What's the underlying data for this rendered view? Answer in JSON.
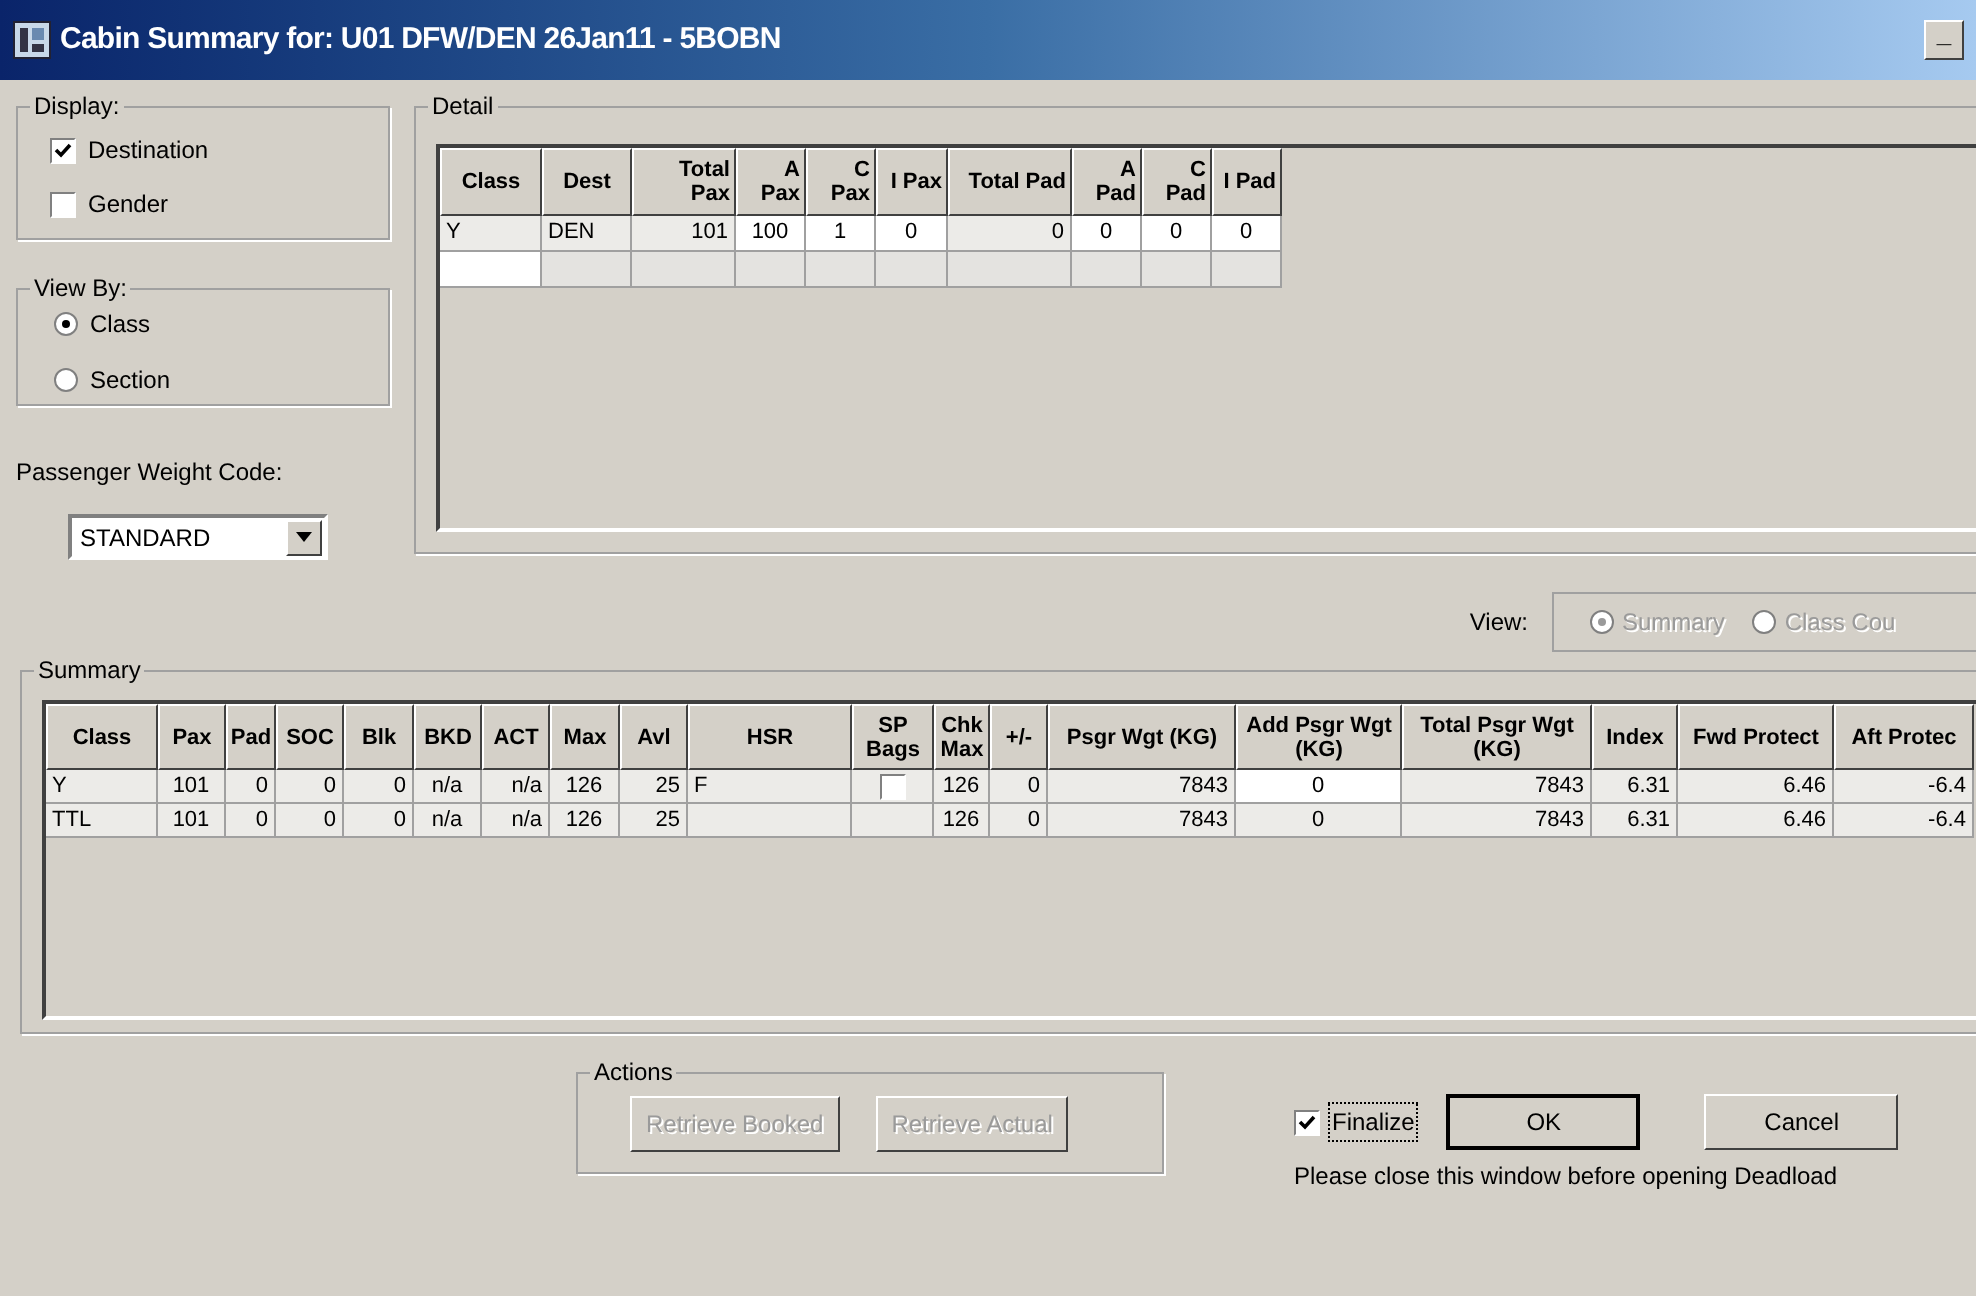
{
  "window": {
    "title": "Cabin Summary for: U01 DFW/DEN 26Jan11 - 5BOBN",
    "controls": [
      "_"
    ]
  },
  "display": {
    "label": "Display:",
    "options": [
      {
        "label": "Destination",
        "checked": true
      },
      {
        "label": "Gender",
        "checked": false
      }
    ]
  },
  "view_by": {
    "label": "View By:",
    "options": [
      {
        "label": "Class",
        "selected": true
      },
      {
        "label": "Section",
        "selected": false
      }
    ]
  },
  "weight_code": {
    "label": "Passenger Weight Code:",
    "value": "STANDARD"
  },
  "detail": {
    "label": "Detail",
    "columns": [
      "Class",
      "Dest",
      "Total Pax",
      "A Pax",
      "C Pax",
      "I Pax",
      "Total Pad",
      "A Pad",
      "C Pad",
      "I Pad"
    ],
    "rows": [
      {
        "cells": [
          "Y",
          "DEN",
          "101",
          "100",
          "1",
          "0",
          "0",
          "0",
          "0",
          "0"
        ]
      }
    ]
  },
  "view": {
    "label": "View:",
    "disabled": true,
    "options": [
      {
        "label": "Summary",
        "selected": true
      },
      {
        "label": "Class Cou",
        "selected": false
      }
    ]
  },
  "summary": {
    "label": "Summary",
    "columns": [
      "Class",
      "Pax",
      "Pad",
      "SOC",
      "Blk",
      "BKD",
      "ACT",
      "Max",
      "Avl",
      "HSR",
      "SP Bags",
      "Chk Max",
      "+/-",
      "Psgr Wgt (KG)",
      "Add Psgr Wgt (KG)",
      "Total Psgr Wgt (KG)",
      "Index",
      "Fwd Protect",
      "Aft Protec"
    ],
    "rows": [
      {
        "cells": [
          "Y",
          "101",
          "0",
          "0",
          "0",
          "n/a",
          "n/a",
          "126",
          "25",
          "F",
          {
            "kind": "checkbox",
            "checked": false
          },
          "126",
          "0",
          "7843",
          "0",
          "7843",
          "6.31",
          "6.46",
          "-6.4"
        ]
      },
      {
        "cells": [
          "TTL",
          "101",
          "0",
          "0",
          "0",
          "n/a",
          "n/a",
          "126",
          "25",
          null,
          null,
          "126",
          "0",
          "7843",
          "0",
          "7843",
          "6.31",
          "6.46",
          "-6.4"
        ]
      }
    ]
  },
  "actions": {
    "label": "Actions",
    "buttons": [
      {
        "label": "Retrieve Booked",
        "disabled": true
      },
      {
        "label": "Retrieve Actual",
        "disabled": true
      }
    ]
  },
  "finalize": {
    "label": "Finalize",
    "checked": true
  },
  "buttons": [
    {
      "label": "OK",
      "default": true
    },
    {
      "label": "Cancel",
      "default": false
    }
  ],
  "note": "Please close this window before opening Deadload"
}
